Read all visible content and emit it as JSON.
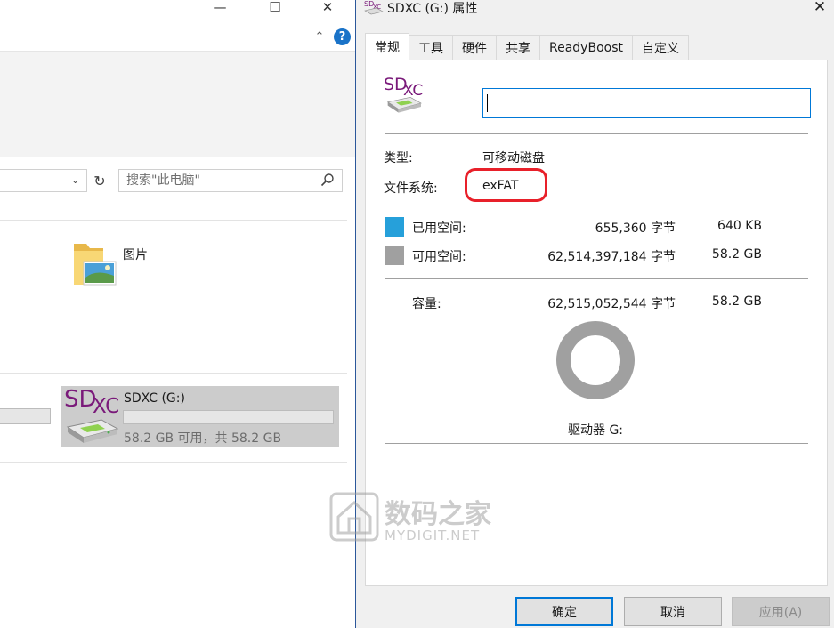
{
  "explorer": {
    "search_placeholder": "搜索\"此电脑\"",
    "folder_pictures": "图片",
    "drive": {
      "logo_main": "SD",
      "logo_sub": "XC",
      "name": "SDXC (G:)",
      "free_text": "58.2 GB 可用，共 58.2 GB",
      "used_fraction": 0.0
    }
  },
  "dialog": {
    "title": "SDXC (G:) 属性",
    "title_logo_main": "SD",
    "title_logo_sub": "XC",
    "logo_main": "SD",
    "logo_sub": "XC",
    "tabs": [
      "常规",
      "工具",
      "硬件",
      "共享",
      "ReadyBoost",
      "自定义"
    ],
    "active_tab": "常规",
    "volume_label_value": "",
    "type_label": "类型:",
    "type_value": "可移动磁盘",
    "fs_label": "文件系统:",
    "fs_value": "exFAT",
    "used_label": "已用空间:",
    "used_bytes": "655,360 字节",
    "used_size": "640 KB",
    "free_label": "可用空间:",
    "free_bytes": "62,514,397,184 字节",
    "free_size": "58.2 GB",
    "capacity_label": "容量:",
    "capacity_bytes": "62,515,052,544 字节",
    "capacity_size": "58.2 GB",
    "drive_label": "驱动器 G:",
    "used_color": "#26a0da",
    "free_color": "#a0a0a0",
    "used_fraction": 1e-05,
    "buttons": {
      "ok": "确定",
      "cancel": "取消",
      "apply": "应用(A)"
    }
  },
  "watermark": {
    "cn": "数码之家",
    "en": "MYDIGIT.NET"
  }
}
